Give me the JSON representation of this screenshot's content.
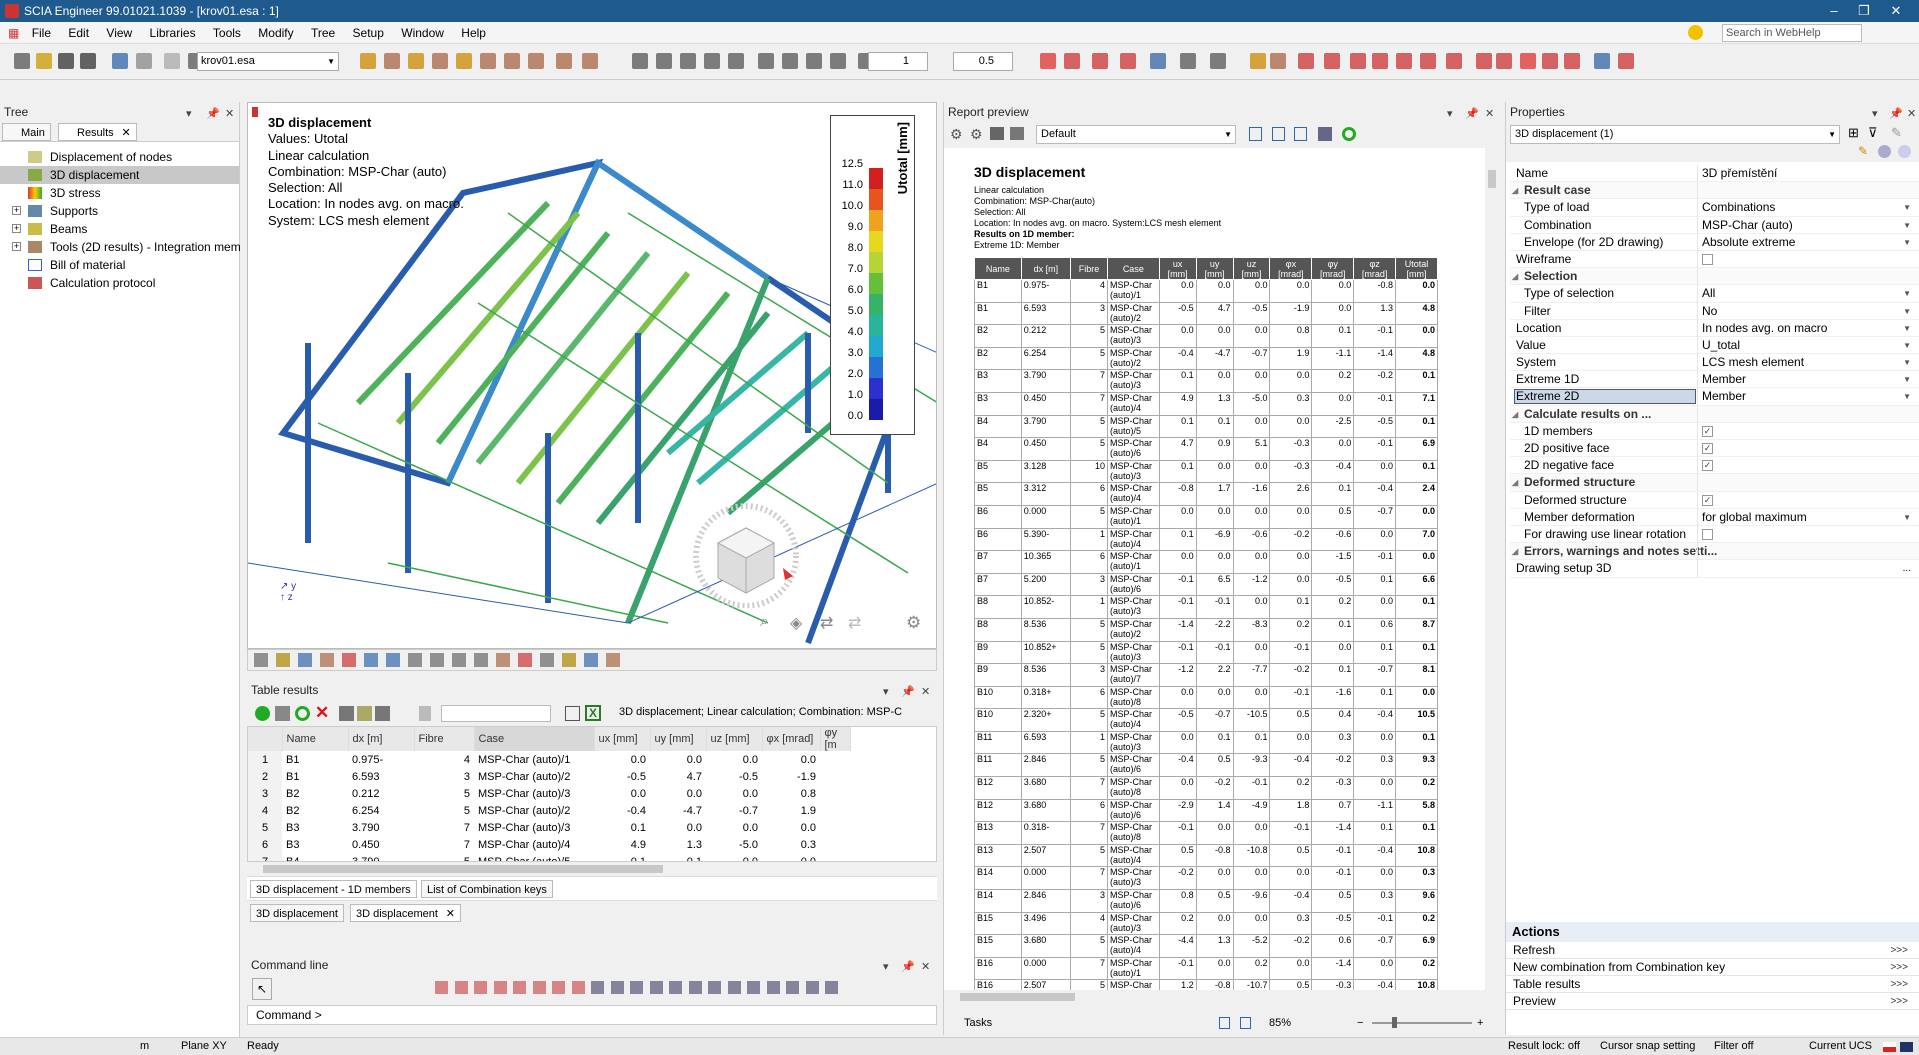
{
  "window": {
    "title": "SCIA Engineer 99.01021.1039 - [krov01.esa : 1]"
  },
  "menu": [
    "File",
    "Edit",
    "View",
    "Libraries",
    "Tools",
    "Modify",
    "Tree",
    "Setup",
    "Window",
    "Help"
  ],
  "toolbar": {
    "project_combo": "krov01.esa",
    "step_value": "1",
    "scale_value": "0.5",
    "search_placeholder": "Search in WebHelp"
  },
  "tree": {
    "title": "Tree",
    "tabs": [
      "Main",
      "Results"
    ],
    "items": [
      "Displacement of nodes",
      "3D displacement",
      "3D stress",
      "Supports",
      "Beams",
      "Tools (2D results) - Integration mem",
      "Bill of material",
      "Calculation protocol"
    ]
  },
  "viewport": {
    "legend_lines": [
      "3D displacement",
      "Values: Utotal",
      "Linear calculation",
      "Combination:  MSP-Char (auto)",
      "Selection: All",
      "Location:  In nodes avg. on macro.",
      "System:  LCS mesh element"
    ],
    "scale_title": "Utotal [mm]",
    "scale_ticks": [
      "12.5",
      "11.0",
      "10.0",
      "9.0",
      "8.0",
      "7.0",
      "6.0",
      "5.0",
      "4.0",
      "3.0",
      "2.0",
      "1.0",
      "0.0"
    ]
  },
  "table_results": {
    "title": "Table results",
    "info": "3D displacement; Linear calculation; Combination: MSP-C",
    "columns": [
      "",
      "Name",
      "dx [m]",
      "Fibre",
      "Case",
      "ux [mm]",
      "uy [mm]",
      "uz [mm]",
      "φx [mrad]",
      "φy [m"
    ],
    "rows": [
      [
        "1",
        "B1",
        "0.975-",
        "4",
        "MSP-Char (auto)/1",
        "0.0",
        "0.0",
        "0.0",
        "0.0"
      ],
      [
        "2",
        "B1",
        "6.593",
        "3",
        "MSP-Char (auto)/2",
        "-0.5",
        "4.7",
        "-0.5",
        "-1.9"
      ],
      [
        "3",
        "B2",
        "0.212",
        "5",
        "MSP-Char (auto)/3",
        "0.0",
        "0.0",
        "0.0",
        "0.8"
      ],
      [
        "4",
        "B2",
        "6.254",
        "5",
        "MSP-Char (auto)/2",
        "-0.4",
        "-4.7",
        "-0.7",
        "1.9"
      ],
      [
        "5",
        "B3",
        "3.790",
        "7",
        "MSP-Char (auto)/3",
        "0.1",
        "0.0",
        "0.0",
        "0.0"
      ],
      [
        "6",
        "B3",
        "0.450",
        "7",
        "MSP-Char (auto)/4",
        "4.9",
        "1.3",
        "-5.0",
        "0.3"
      ],
      [
        "7",
        "B4",
        "3.790",
        "5",
        "MSP-Char (auto)/5",
        "0.1",
        "0.1",
        "0.0",
        "0.0"
      ]
    ],
    "bottom_tabs": [
      "3D displacement - 1D members",
      "List of Combination keys"
    ],
    "doc_tabs": [
      "3D displacement",
      "3D displacement"
    ]
  },
  "command_line": {
    "title": "Command line",
    "prompt": "Command >"
  },
  "report": {
    "title": "Report preview",
    "style_combo": "Default",
    "heading": "3D displacement",
    "meta": [
      "Linear calculation",
      "Combination: MSP-Char(auto)",
      "Selection: All",
      "Location: In nodes avg. on macro. System:LCS mesh element"
    ],
    "result_line": "Results on 1D member:",
    "extreme_line": "Extreme 1D: Member",
    "columns": [
      "Name",
      "dx [m]",
      "Fibre",
      "Case",
      "ux [mm]",
      "uy [mm]",
      "uz [mm]",
      "φx [mrad]",
      "φy [mrad]",
      "φz [mrad]",
      "Utotal [mm]"
    ],
    "rows": [
      [
        "B1",
        "0.975-",
        "4",
        "MSP-Char (auto)/1",
        "0.0",
        "0.0",
        "0.0",
        "0.0",
        "0.0",
        "-0.8",
        "0.0"
      ],
      [
        "B1",
        "6.593",
        "3",
        "MSP-Char (auto)/2",
        "-0.5",
        "4.7",
        "-0.5",
        "-1.9",
        "0.0",
        "1.3",
        "4.8"
      ],
      [
        "B2",
        "0.212",
        "5",
        "MSP-Char (auto)/3",
        "0.0",
        "0.0",
        "0.0",
        "0.8",
        "0.1",
        "-0.1",
        "0.0"
      ],
      [
        "B2",
        "6.254",
        "5",
        "MSP-Char (auto)/2",
        "-0.4",
        "-4.7",
        "-0.7",
        "1.9",
        "-1.1",
        "-1.4",
        "4.8"
      ],
      [
        "B3",
        "3.790",
        "7",
        "MSP-Char (auto)/3",
        "0.1",
        "0.0",
        "0.0",
        "0.0",
        "0.2",
        "-0.2",
        "0.1"
      ],
      [
        "B3",
        "0.450",
        "7",
        "MSP-Char (auto)/4",
        "4.9",
        "1.3",
        "-5.0",
        "0.3",
        "0.0",
        "-0.1",
        "7.1"
      ],
      [
        "B4",
        "3.790",
        "5",
        "MSP-Char (auto)/5",
        "0.1",
        "0.1",
        "0.0",
        "0.0",
        "-2.5",
        "-0.5",
        "0.1"
      ],
      [
        "B4",
        "0.450",
        "5",
        "MSP-Char (auto)/6",
        "4.7",
        "0.9",
        "5.1",
        "-0.3",
        "0.0",
        "-0.1",
        "6.9"
      ],
      [
        "B5",
        "3.128",
        "10",
        "MSP-Char (auto)/3",
        "0.1",
        "0.0",
        "0.0",
        "-0.3",
        "-0.4",
        "0.0",
        "0.1"
      ],
      [
        "B5",
        "3.312",
        "6",
        "MSP-Char (auto)/4",
        "-0.8",
        "1.7",
        "-1.6",
        "2.6",
        "0.1",
        "-0.4",
        "2.4"
      ],
      [
        "B6",
        "0.000",
        "5",
        "MSP-Char (auto)/1",
        "0.0",
        "0.0",
        "0.0",
        "0.0",
        "0.5",
        "-0.7",
        "0.0"
      ],
      [
        "B6",
        "5.390-",
        "1",
        "MSP-Char (auto)/4",
        "0.1",
        "-6.9",
        "-0.6",
        "-0.2",
        "-0.6",
        "0.0",
        "7.0"
      ],
      [
        "B7",
        "10.365",
        "6",
        "MSP-Char (auto)/1",
        "0.0",
        "0.0",
        "0.0",
        "0.0",
        "-1.5",
        "-0.1",
        "0.0"
      ],
      [
        "B7",
        "5.200",
        "3",
        "MSP-Char (auto)/6",
        "-0.1",
        "6.5",
        "-1.2",
        "0.0",
        "-0.5",
        "0.1",
        "6.6"
      ],
      [
        "B8",
        "10.852-",
        "1",
        "MSP-Char (auto)/3",
        "-0.1",
        "-0.1",
        "0.0",
        "0.1",
        "0.2",
        "0.0",
        "0.1"
      ],
      [
        "B8",
        "8.536",
        "5",
        "MSP-Char (auto)/2",
        "-1.4",
        "-2.2",
        "-8.3",
        "0.2",
        "0.1",
        "0.6",
        "8.7"
      ],
      [
        "B9",
        "10.852+",
        "5",
        "MSP-Char (auto)/3",
        "-0.1",
        "-0.1",
        "0.0",
        "-0.1",
        "0.0",
        "0.1",
        "0.1"
      ],
      [
        "B9",
        "8.536",
        "3",
        "MSP-Char (auto)/7",
        "-1.2",
        "2.2",
        "-7.7",
        "-0.2",
        "0.1",
        "-0.7",
        "8.1"
      ],
      [
        "B10",
        "0.318+",
        "6",
        "MSP-Char (auto)/8",
        "0.0",
        "0.0",
        "0.0",
        "-0.1",
        "-1.6",
        "0.1",
        "0.0"
      ],
      [
        "B10",
        "2.320+",
        "5",
        "MSP-Char (auto)/4",
        "-0.5",
        "-0.7",
        "-10.5",
        "0.5",
        "0.4",
        "-0.4",
        "10.5"
      ],
      [
        "B11",
        "6.593",
        "1",
        "MSP-Char (auto)/3",
        "0.0",
        "0.1",
        "0.1",
        "0.0",
        "0.3",
        "0.0",
        "0.1"
      ],
      [
        "B11",
        "2.846",
        "5",
        "MSP-Char (auto)/6",
        "-0.4",
        "0.5",
        "-9.3",
        "-0.4",
        "-0.2",
        "0.3",
        "9.3"
      ],
      [
        "B12",
        "3.680",
        "7",
        "MSP-Char (auto)/8",
        "0.0",
        "-0.2",
        "-0.1",
        "0.2",
        "-0.3",
        "0.0",
        "0.2"
      ],
      [
        "B12",
        "3.680",
        "6",
        "MSP-Char (auto)/6",
        "-2.9",
        "1.4",
        "-4.9",
        "1.8",
        "0.7",
        "-1.1",
        "5.8"
      ],
      [
        "B13",
        "0.318-",
        "7",
        "MSP-Char (auto)/8",
        "-0.1",
        "0.0",
        "0.0",
        "-0.1",
        "-1.4",
        "0.1",
        "0.1"
      ],
      [
        "B13",
        "2.507",
        "5",
        "MSP-Char (auto)/4",
        "0.5",
        "-0.8",
        "-10.8",
        "0.5",
        "-0.1",
        "-0.4",
        "10.8"
      ],
      [
        "B14",
        "0.000",
        "7",
        "MSP-Char (auto)/3",
        "-0.2",
        "0.0",
        "0.0",
        "0.0",
        "-0.1",
        "0.0",
        "0.3"
      ],
      [
        "B14",
        "2.846",
        "3",
        "MSP-Char (auto)/6",
        "0.8",
        "0.5",
        "-9.6",
        "-0.4",
        "0.5",
        "0.3",
        "9.6"
      ],
      [
        "B15",
        "3.496",
        "4",
        "MSP-Char (auto)/3",
        "0.2",
        "0.0",
        "0.0",
        "0.3",
        "-0.5",
        "-0.1",
        "0.2"
      ],
      [
        "B15",
        "3.680",
        "5",
        "MSP-Char (auto)/4",
        "-4.4",
        "1.3",
        "-5.2",
        "-0.2",
        "0.6",
        "-0.7",
        "6.9"
      ],
      [
        "B16",
        "0.000",
        "7",
        "MSP-Char (auto)/1",
        "-0.1",
        "0.0",
        "0.2",
        "0.0",
        "-1.4",
        "0.0",
        "0.2"
      ],
      [
        "B16",
        "2.507",
        "5",
        "MSP-Char",
        "1.2",
        "-0.8",
        "-10.7",
        "0.5",
        "-0.3",
        "-0.4",
        "10.8"
      ]
    ],
    "tasks_label": "Tasks",
    "zoom": "85%"
  },
  "properties": {
    "title": "Properties",
    "combo": "3D displacement (1)",
    "rows": [
      {
        "k": "Name",
        "v": "3D přemístění",
        "t": "plain"
      },
      {
        "k": "Result case",
        "v": "",
        "t": "sec"
      },
      {
        "k": "Type of load",
        "v": "Combinations",
        "t": "dd"
      },
      {
        "k": "Combination",
        "v": "MSP-Char (auto)",
        "t": "dd"
      },
      {
        "k": "Envelope (for 2D drawing)",
        "v": "Absolute extreme",
        "t": "dd"
      },
      {
        "k": "Wireframe",
        "v": "",
        "t": "chk0"
      },
      {
        "k": "Selection",
        "v": "",
        "t": "sec"
      },
      {
        "k": "Type of selection",
        "v": "All",
        "t": "dd"
      },
      {
        "k": "Filter",
        "v": "No",
        "t": "dd"
      },
      {
        "k": "Location",
        "v": "In nodes avg. on macro",
        "t": "dd"
      },
      {
        "k": "Value",
        "v": "U_total",
        "t": "dd"
      },
      {
        "k": "System",
        "v": "LCS mesh element",
        "t": "dd"
      },
      {
        "k": "Extreme 1D",
        "v": "Member",
        "t": "dd"
      },
      {
        "k": "Extreme 2D",
        "v": "Member",
        "t": "ddsel"
      },
      {
        "k": "Calculate results on ...",
        "v": "",
        "t": "sec"
      },
      {
        "k": "1D members",
        "v": "",
        "t": "chk1"
      },
      {
        "k": "2D positive face",
        "v": "",
        "t": "chk1"
      },
      {
        "k": "2D negative face",
        "v": "",
        "t": "chk1"
      },
      {
        "k": "Deformed structure",
        "v": "",
        "t": "sec"
      },
      {
        "k": "Deformed structure",
        "v": "",
        "t": "chk1"
      },
      {
        "k": "Member deformation",
        "v": "for global maximum",
        "t": "dd"
      },
      {
        "k": "For drawing use linear rotation",
        "v": "",
        "t": "chk0"
      },
      {
        "k": "Errors, warnings and notes setti...",
        "v": "",
        "t": "sec"
      },
      {
        "k": "Drawing setup 3D",
        "v": "",
        "t": "more"
      }
    ],
    "actions_title": "Actions",
    "actions": [
      "Refresh",
      "New combination from Combination key",
      "Table results",
      "Preview"
    ],
    "actions_arrow": ">>>"
  },
  "status": {
    "units": "m",
    "plane": "Plane XY",
    "state": "Ready",
    "result_lock": "Result lock: off",
    "snap": "Cursor snap setting",
    "filter": "Filter off",
    "ucs": "Current UCS"
  }
}
